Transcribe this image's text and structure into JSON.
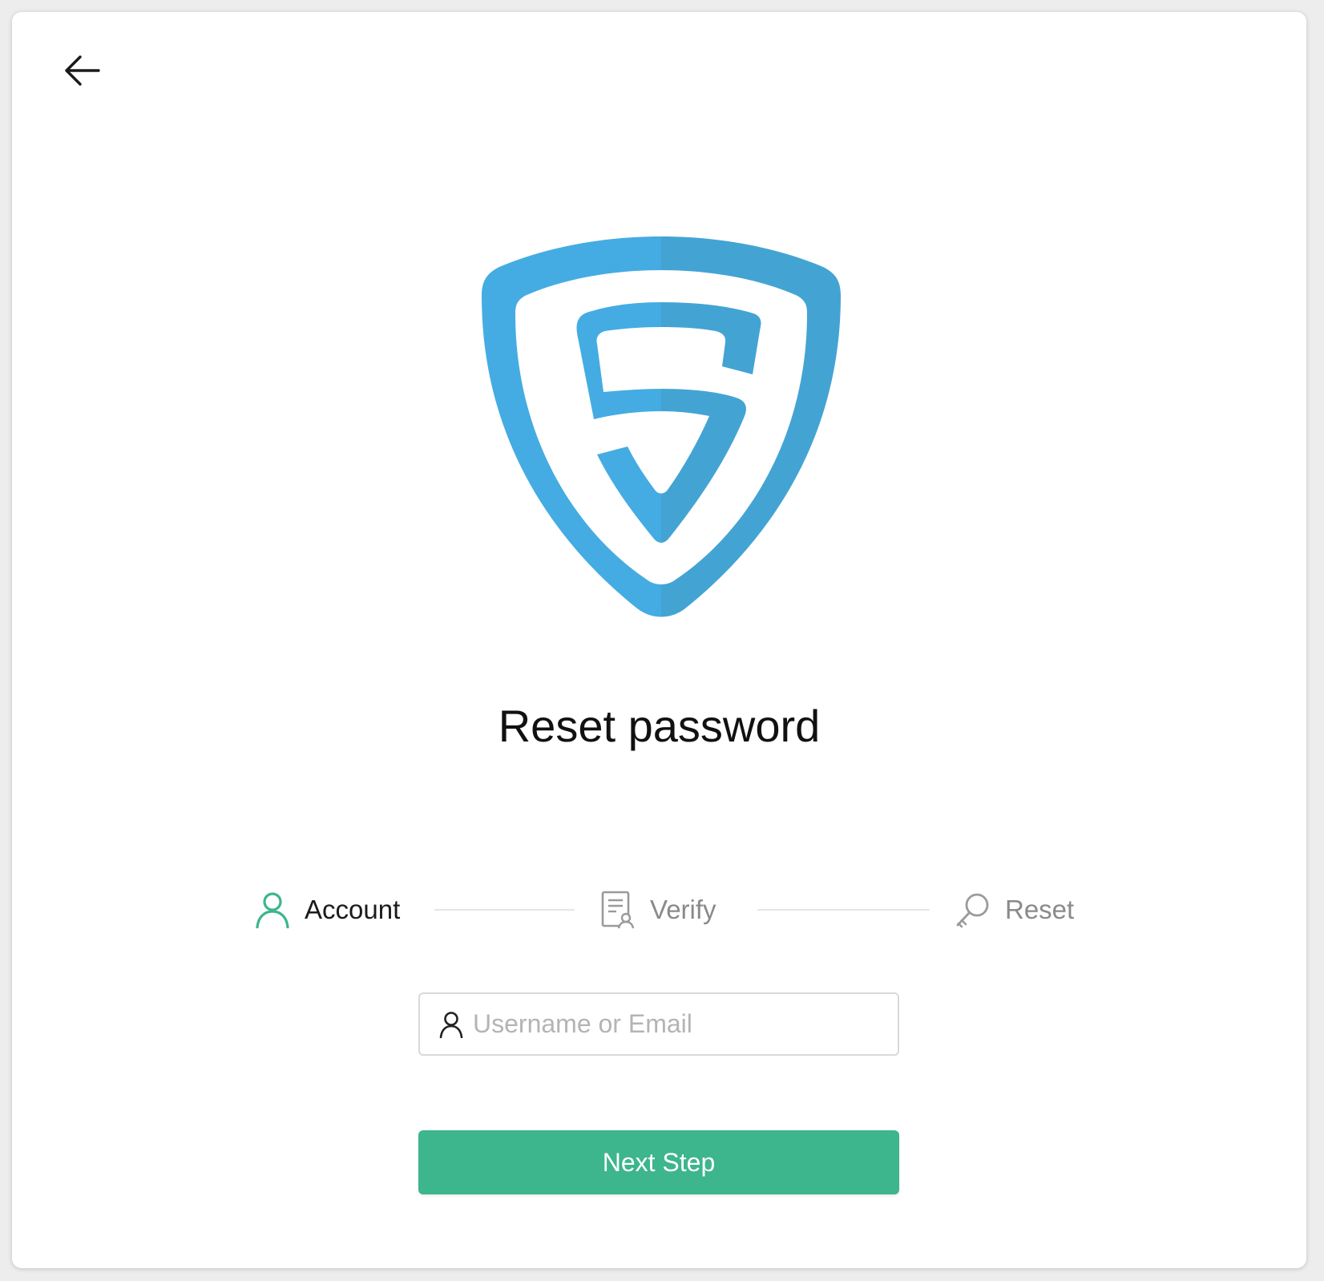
{
  "header": {
    "back_icon": "arrow-left-icon"
  },
  "logo": {
    "icon": "shield-s-logo",
    "color_light": "#44ace2",
    "color_dark": "#43a4d4"
  },
  "page": {
    "title": "Reset password"
  },
  "steps": [
    {
      "label": "Account",
      "icon": "user-icon",
      "state": "active"
    },
    {
      "label": "Verify",
      "icon": "document-user-icon",
      "state": "inactive"
    },
    {
      "label": "Reset",
      "icon": "key-icon",
      "state": "inactive"
    }
  ],
  "form": {
    "username_placeholder": "Username or Email",
    "username_value": "",
    "username_icon": "user-icon",
    "next_label": "Next Step"
  },
  "colors": {
    "accent": "#3db58d",
    "inactive": "#8a8a8a"
  }
}
